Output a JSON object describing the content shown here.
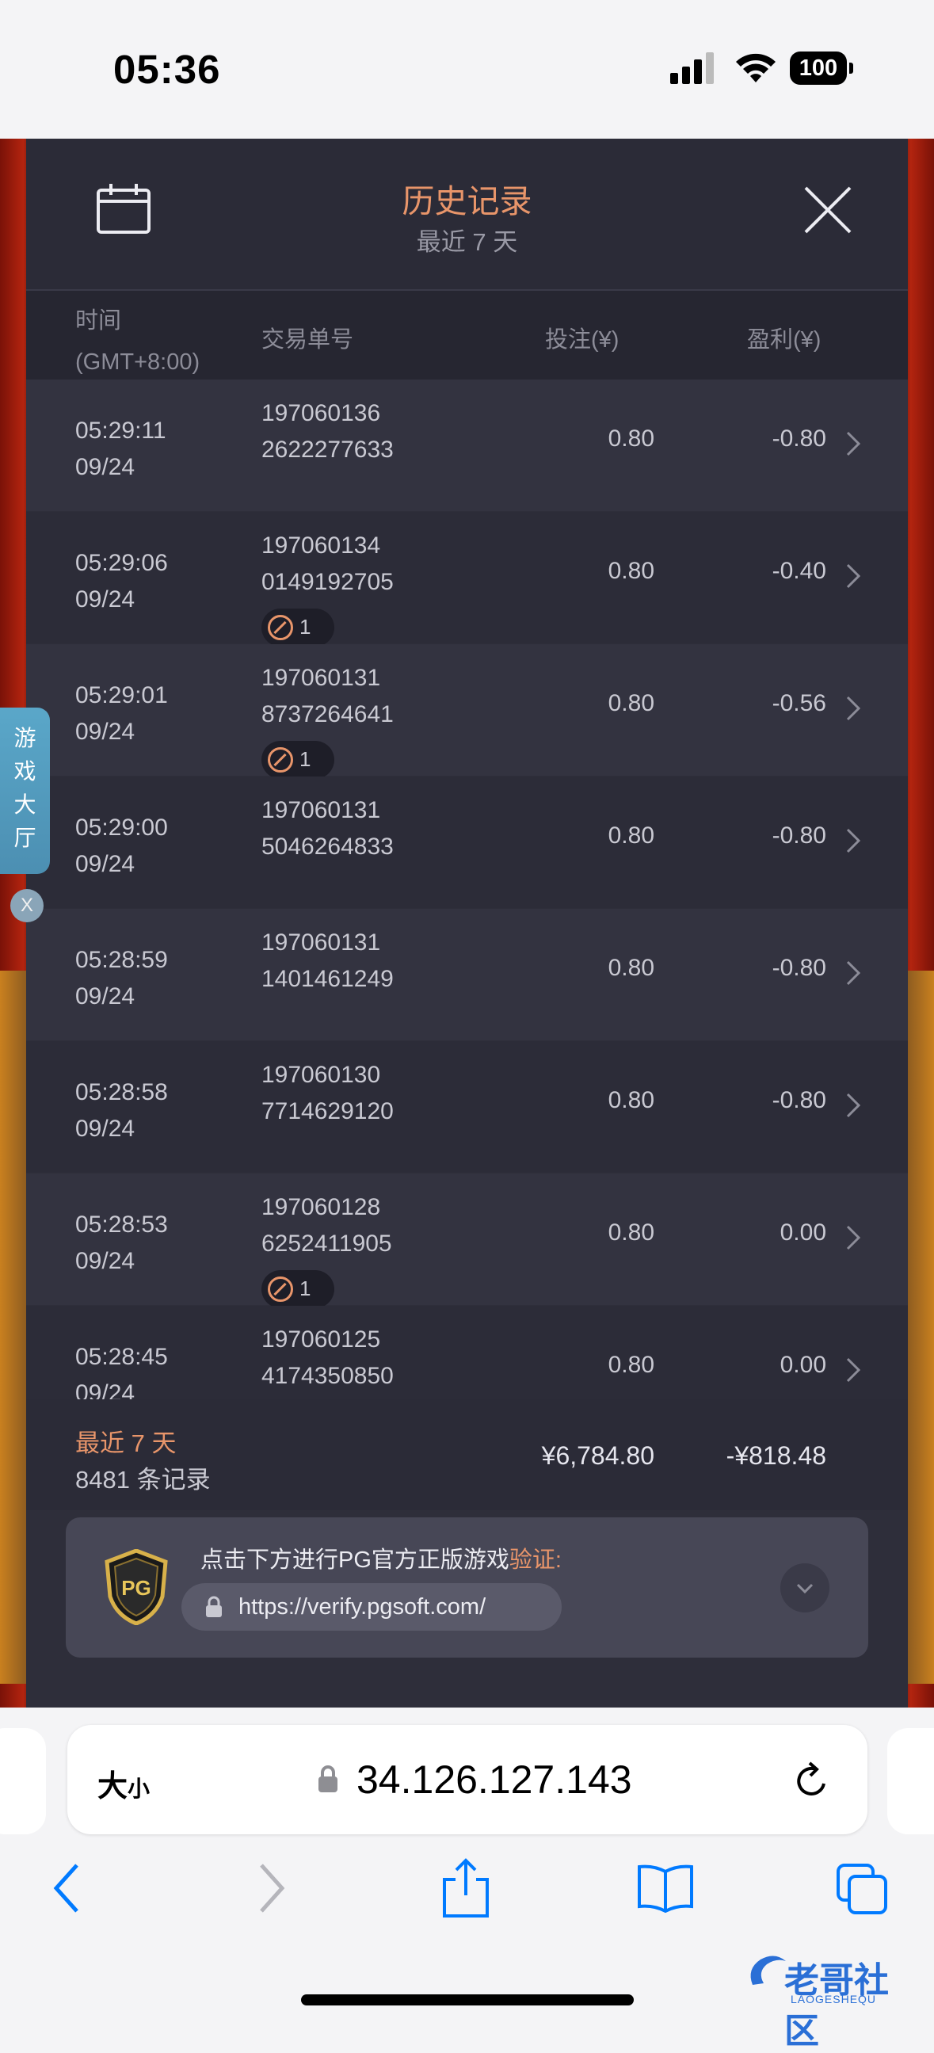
{
  "status_bar": {
    "time": "05:36",
    "battery": "100"
  },
  "history": {
    "title": "历史记录",
    "subtitle": "最近 7 天",
    "columns": {
      "time_line1": "时间",
      "time_line2": "(GMT+8:00)",
      "order_id": "交易单号",
      "bet": "投注(¥)",
      "profit": "盈利(¥)"
    },
    "rows": [
      {
        "time": "05:29:11",
        "date": "09/24",
        "id1": "197060136",
        "id2": "2622277633",
        "bet": "0.80",
        "profit": "-0.80",
        "badge": ""
      },
      {
        "time": "05:29:06",
        "date": "09/24",
        "id1": "197060134",
        "id2": "0149192705",
        "bet": "0.80",
        "profit": "-0.40",
        "badge": "1"
      },
      {
        "time": "05:29:01",
        "date": "09/24",
        "id1": "197060131",
        "id2": "8737264641",
        "bet": "0.80",
        "profit": "-0.56",
        "badge": "1"
      },
      {
        "time": "05:29:00",
        "date": "09/24",
        "id1": "197060131",
        "id2": "5046264833",
        "bet": "0.80",
        "profit": "-0.80",
        "badge": ""
      },
      {
        "time": "05:28:59",
        "date": "09/24",
        "id1": "197060131",
        "id2": "1401461249",
        "bet": "0.80",
        "profit": "-0.80",
        "badge": ""
      },
      {
        "time": "05:28:58",
        "date": "09/24",
        "id1": "197060130",
        "id2": "7714629120",
        "bet": "0.80",
        "profit": "-0.80",
        "badge": ""
      },
      {
        "time": "05:28:53",
        "date": "09/24",
        "id1": "197060128",
        "id2": "6252411905",
        "bet": "0.80",
        "profit": "0.00",
        "badge": "1"
      },
      {
        "time": "05:28:45",
        "date": "09/24",
        "id1": "197060125",
        "id2": "4174350850",
        "bet": "0.80",
        "profit": "0.00",
        "badge": ""
      }
    ],
    "summary": {
      "period": "最近 7 天",
      "count": "8481 条记录",
      "total_bet": "¥6,784.80",
      "total_profit": "-¥818.48"
    },
    "verify": {
      "text": "点击下方进行PG官方正版游戏",
      "highlight": "验证:",
      "url": "https://verify.pgsoft.com/",
      "logo": "PG"
    }
  },
  "lobby": {
    "label": "游戏大厅",
    "close": "X"
  },
  "browser": {
    "aa_big": "大",
    "aa_small": "小",
    "url": "34.126.127.143"
  },
  "watermark": {
    "text": "老哥社区",
    "sub": "LAOGESHEQU"
  },
  "colors": {
    "accent": "#e8956a",
    "panel": "#2e2e3a",
    "ios_blue": "#007aff"
  }
}
